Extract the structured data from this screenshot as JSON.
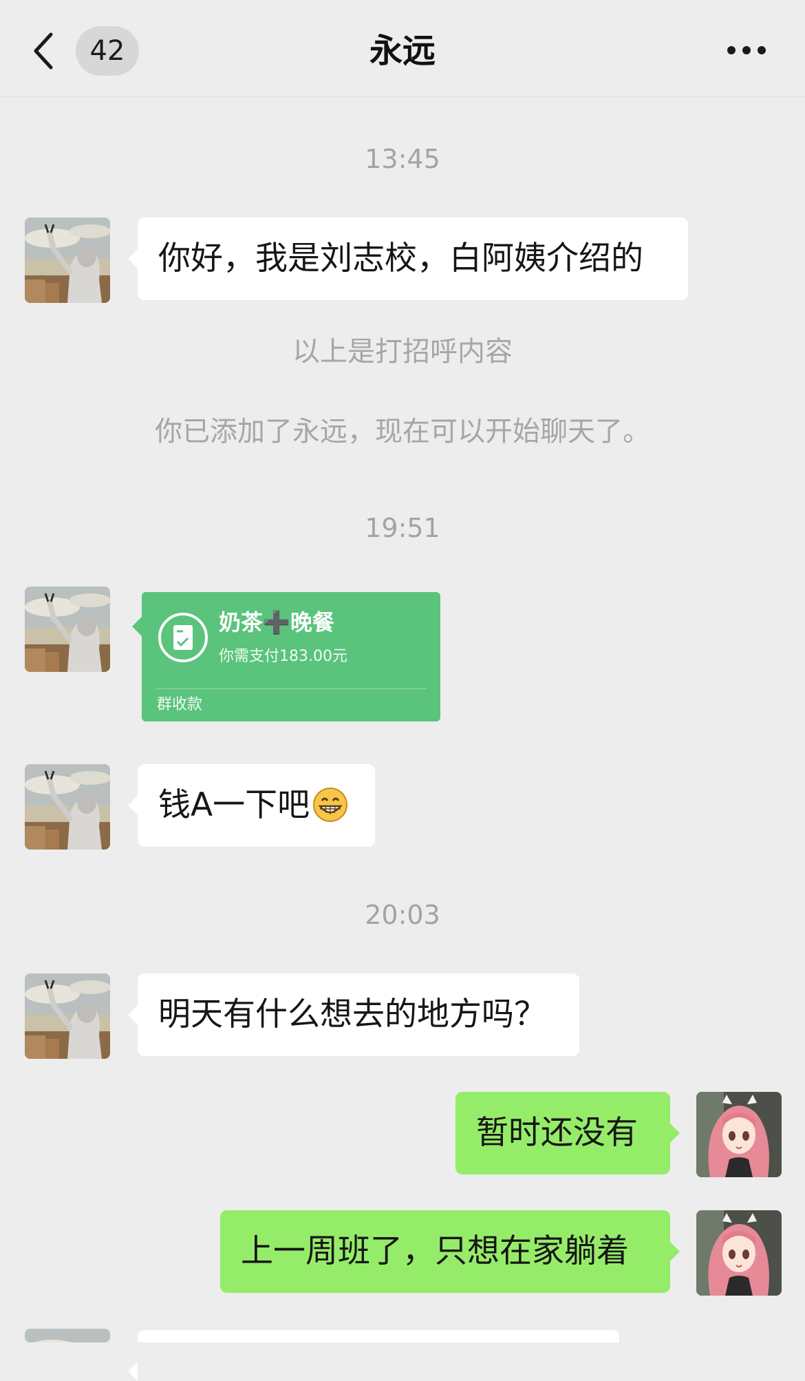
{
  "header": {
    "unread_count": "42",
    "title": "永远"
  },
  "messages": [
    {
      "type": "timestamp",
      "text": "13:45"
    },
    {
      "type": "incoming",
      "text": "你好，我是刘志校，白阿姨介绍的"
    },
    {
      "type": "system",
      "text": "以上是打招呼内容"
    },
    {
      "type": "system",
      "text": "你已添加了永远，现在可以开始聊天了。"
    },
    {
      "type": "timestamp",
      "text": "19:51"
    },
    {
      "type": "group_collection",
      "title": "奶茶➕晚餐",
      "amount_text": "你需支付183.00元",
      "label": "群收款"
    },
    {
      "type": "incoming",
      "text": "钱A一下吧",
      "emoji": "grinning-face"
    },
    {
      "type": "timestamp",
      "text": "20:03"
    },
    {
      "type": "incoming",
      "text": "明天有什么想去的地方吗？"
    },
    {
      "type": "outgoing",
      "text": "暂时还没有"
    },
    {
      "type": "outgoing",
      "text": "上一周班了，只想在家躺着"
    }
  ],
  "colors": {
    "background": "#ededed",
    "incoming_bubble": "#ffffff",
    "outgoing_bubble": "#95ec69",
    "payment_card": "#5ac37c"
  }
}
